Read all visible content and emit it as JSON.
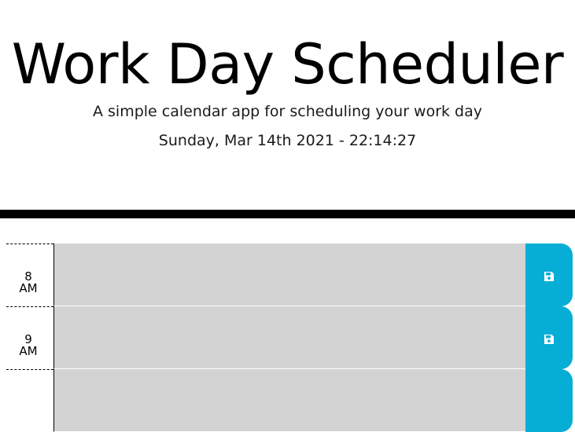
{
  "header": {
    "title": "Work Day Scheduler",
    "subtitle": "A simple calendar app for scheduling your work day",
    "current_day": "Sunday, Mar 14th 2021 - 22:14:27"
  },
  "schedule": {
    "rows": [
      {
        "hour": "8",
        "period": "AM",
        "description": "",
        "status": "past"
      },
      {
        "hour": "9",
        "period": "AM",
        "description": "",
        "status": "past"
      },
      {
        "hour": "",
        "period": "",
        "description": "",
        "status": "past"
      }
    ],
    "save_icon": "floppy-disk-icon"
  },
  "colors": {
    "past": "#d3d3d3",
    "save_button": "#06aed5",
    "divider": "#000000"
  }
}
